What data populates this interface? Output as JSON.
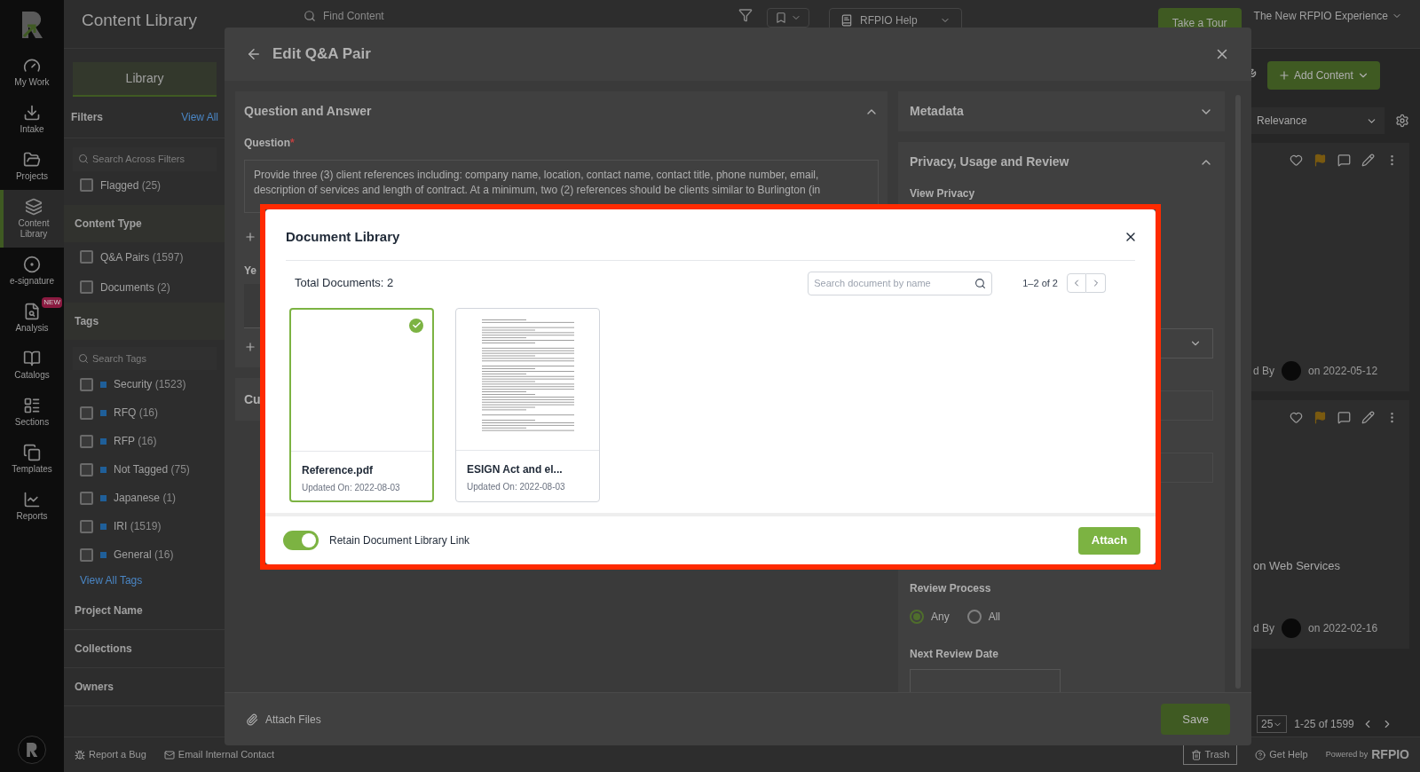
{
  "nav_rail": {
    "items": [
      {
        "label": "My Work",
        "selected": false
      },
      {
        "label": "Intake",
        "selected": false
      },
      {
        "label": "Projects",
        "selected": false
      },
      {
        "label": "Content Library",
        "selected": true
      },
      {
        "label": "e-signature",
        "selected": false
      },
      {
        "label": "Analysis",
        "selected": false,
        "badge": "NEW"
      },
      {
        "label": "Catalogs",
        "selected": false
      },
      {
        "label": "Sections",
        "selected": false
      },
      {
        "label": "Templates",
        "selected": false
      },
      {
        "label": "Reports",
        "selected": false
      }
    ]
  },
  "header": {
    "title": "Content Library",
    "search": {
      "placeholder": "Find Content"
    },
    "help": "RFPIO Help",
    "tour_button": "Take a Tour",
    "experience": "The New RFPIO Experience"
  },
  "filters": {
    "tab": "Library",
    "title": "Filters",
    "view_all": "View All",
    "search": {
      "placeholder": "Search Across Filters"
    },
    "flagged": {
      "label": "Flagged",
      "count": "(25)",
      "checked": false
    },
    "content_type": {
      "title": "Content Type",
      "options": [
        {
          "label": "Q&A Pairs",
          "count": "(1597)",
          "checked": false
        },
        {
          "label": "Documents",
          "count": "(2)",
          "checked": false
        }
      ]
    },
    "tags": {
      "title": "Tags",
      "search": {
        "placeholder": "Search Tags"
      },
      "items": [
        {
          "label": "Security",
          "count": "(1523)",
          "checked": false,
          "color": "#1f5f99"
        },
        {
          "label": "RFQ",
          "count": "(16)",
          "checked": false,
          "color": "#1f5f99"
        },
        {
          "label": "RFP",
          "count": "(16)",
          "checked": false,
          "color": "#1f5f99"
        },
        {
          "label": "Not Tagged",
          "count": "(75)",
          "checked": false,
          "color": "#1f5f99"
        },
        {
          "label": "Japanese",
          "count": "(1)",
          "checked": false,
          "color": "#1f5f99"
        },
        {
          "label": "IRI",
          "count": "(1519)",
          "checked": false,
          "color": "#1f5f99"
        },
        {
          "label": "General",
          "count": "(16)",
          "checked": false,
          "color": "#1f5f99"
        }
      ],
      "view_all": "View All Tags"
    },
    "collapsed_sections": [
      "Project Name",
      "Collections",
      "Owners"
    ]
  },
  "results": {
    "add_content": "Add Content",
    "sort": "Relevance",
    "cards": [
      {
        "author_label": "d By",
        "date": "on 2022-05-12"
      },
      {
        "snippet": "on Web Services",
        "author_label": "d By",
        "date": "on 2022-02-16"
      }
    ],
    "page_size": "25",
    "range": "1-25 of 1599"
  },
  "bottom_bar": {
    "report_bug": "Report a Bug",
    "email_contact": "Email Internal Contact",
    "trash": "Trash",
    "get_help": "Get Help",
    "powered_by": "Powered by",
    "brand": "RFPIO"
  },
  "edit_dialog": {
    "title": "Edit Q&A Pair",
    "qa_section": {
      "title": "Question and Answer",
      "expanded": true,
      "question_label": "Question",
      "required_mark": "*",
      "question_text": "Provide three (3) client references including: company name, location, contact name, contact title, phone number, email, description of services and length of contract. At a minimum, two (2) references should be clients similar to Burlington (in",
      "answer_fragment": "Ye",
      "next_section_fragment": "Cu"
    },
    "metadata": {
      "title": "Metadata",
      "expanded": false
    },
    "privacy": {
      "title": "Privacy, Usage and Review",
      "expanded": true,
      "view_privacy": "View Privacy",
      "review_process": {
        "label": "Review Process",
        "options": [
          {
            "label": "Any",
            "selected": true
          },
          {
            "label": "All",
            "selected": false
          }
        ]
      },
      "next_review_date": "Next Review Date"
    },
    "attach_files": "Attach Files",
    "save": "Save"
  },
  "document_library": {
    "title": "Document Library",
    "total": "Total Documents: 2",
    "search": {
      "placeholder": "Search document by name"
    },
    "range": "1–2 of 2",
    "documents": [
      {
        "name": "Reference.pdf",
        "updated": "Updated On: 2022-08-03",
        "selected": true,
        "kind": "blank"
      },
      {
        "name": "ESIGN Act and el...",
        "updated": "Updated On: 2022-08-03",
        "selected": false,
        "kind": "text"
      }
    ],
    "retain_link": {
      "label": "Retain Document Library Link",
      "on": true
    },
    "attach": "Attach"
  }
}
